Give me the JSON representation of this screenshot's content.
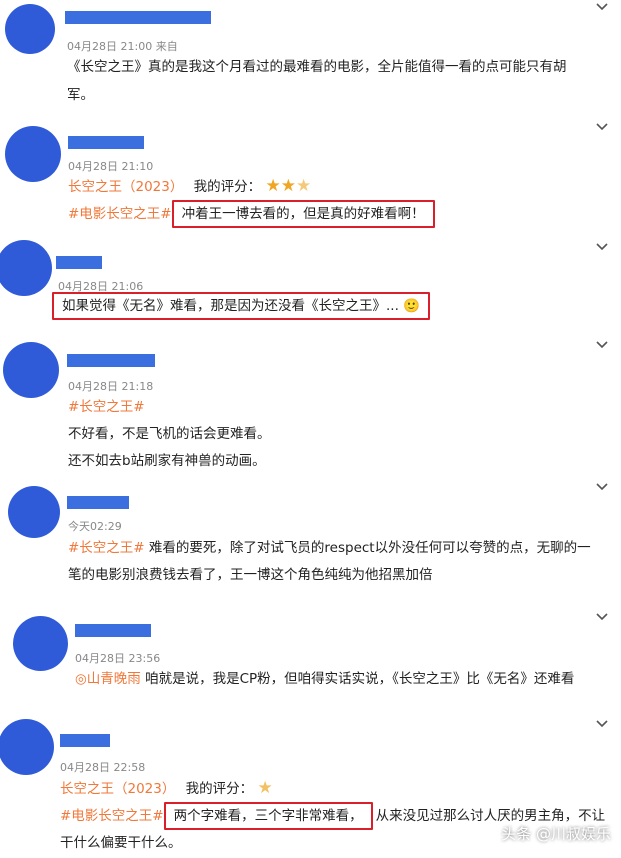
{
  "comments": [
    {
      "time": "04月28日 21:00",
      "suffix": "来自",
      "body": [
        "《长空之王》真的是我这个月看过的最难看的电影，全片能值得一看的点可能只有胡",
        "军。"
      ]
    },
    {
      "time": "04月28日 21:10",
      "movie": "长空之王（2023）",
      "rating_label": "我的评分：",
      "rating": 2.5,
      "tag": "#电影长空之王#",
      "highlight": "冲着王一博去看的，但是真的好难看啊！"
    },
    {
      "time": "04月28日 21:06",
      "highlight": "如果觉得《无名》难看，那是因为还没看《长空之王》...",
      "emoji": "🙂"
    },
    {
      "time": "04月28日 21:18",
      "tag": "#长空之王#",
      "body": [
        "不好看，不是飞机的话会更难看。",
        "还不如去b站刷家有神兽的动画。"
      ]
    },
    {
      "time": "今天02:29",
      "tag": "#长空之王#",
      "body": [
        "难看的要死，除了对试飞员的respect以外没任何可以夸赞的点，无聊的一",
        "笔的电影别浪费钱去看了，王一博这个角色纯纯为他招黑加倍"
      ]
    },
    {
      "time": "04月28日 23:56",
      "user_tag": "◎山青晚雨",
      "body": [
        "咱就是说，我是CP粉，但咱得实话实说，《长空之王》比《无名》还难看"
      ]
    },
    {
      "time": "04月28日 22:58",
      "movie": "长空之王（2023）",
      "rating_label": "我的评分：",
      "rating": 0.5,
      "tag": "#电影长空之王#",
      "highlight": "两个字难看，三个字非常难看，",
      "after": "从来没见过那么讨人厌的男主角，不让",
      "body2": "干什么偏要干什么。"
    }
  ],
  "icons": {
    "chevron": "chevron-down-icon",
    "star": "star-icon"
  },
  "watermark": "头条 @川叔娱乐"
}
